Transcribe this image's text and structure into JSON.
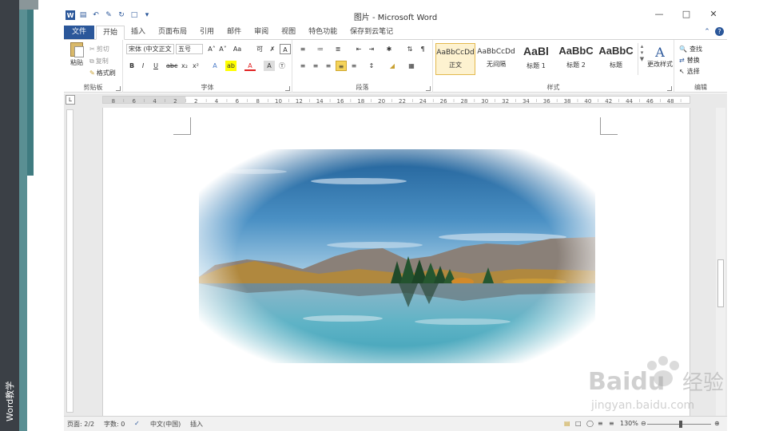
{
  "side_label": "Word教学",
  "window": {
    "title": "图片 - Microsoft Word",
    "logo_letter": "W"
  },
  "tabs": {
    "file": "文件",
    "items": [
      "开始",
      "插入",
      "页面布局",
      "引用",
      "邮件",
      "审阅",
      "视图",
      "特色功能",
      "保存到云笔记"
    ]
  },
  "ribbon": {
    "clipboard": {
      "label": "剪贴板",
      "paste": "粘贴",
      "cut": "剪切",
      "copy": "复制",
      "format_painter": "格式刷"
    },
    "font": {
      "label": "字体",
      "font_name": "宋体 (中文正文",
      "font_size": "五号"
    },
    "paragraph": {
      "label": "段落"
    },
    "styles": {
      "label": "样式",
      "cards": [
        {
          "sample": "AaBbCcDd",
          "name": "正文"
        },
        {
          "sample": "AaBbCcDd",
          "name": "无间隔"
        },
        {
          "sample": "AaBl",
          "name": "标题 1"
        },
        {
          "sample": "AaBbC",
          "name": "标题 2"
        },
        {
          "sample": "AaBbC",
          "name": "标题"
        }
      ],
      "change_styles": "更改样式"
    },
    "editing": {
      "label": "编辑",
      "find": "查找",
      "replace": "替换",
      "select": "选择"
    }
  },
  "ruler_numbers": [
    "8",
    "6",
    "4",
    "2",
    "2",
    "4",
    "6",
    "8",
    "10",
    "12",
    "14",
    "16",
    "18",
    "20",
    "22",
    "24",
    "26",
    "28",
    "30",
    "32",
    "34",
    "36",
    "38",
    "40",
    "42",
    "44",
    "46",
    "48"
  ],
  "status": {
    "page": "页面: 2/2",
    "words": "字数: 0",
    "language": "中文(中国)",
    "mode": "插入",
    "zoom": "130%"
  },
  "watermark": {
    "brand": "Baidu",
    "cn": "经验",
    "url": "jingyan.baidu.com"
  }
}
